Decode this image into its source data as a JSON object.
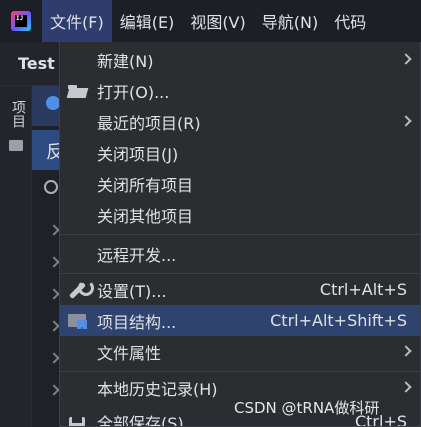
{
  "menubar": {
    "logo_text": "IJ",
    "items": [
      {
        "label": "文件(F)"
      },
      {
        "label": "编辑(E)"
      },
      {
        "label": "视图(V)"
      },
      {
        "label": "导航(N)"
      },
      {
        "label": "代码"
      }
    ]
  },
  "background": {
    "tab_label": "Test",
    "sidebar_label": "项目",
    "panel_row_text": "反"
  },
  "file_menu": {
    "items": [
      {
        "label": "新建(N)",
        "shortcut": "",
        "has_submenu": true,
        "icon": ""
      },
      {
        "label": "打开(O)...",
        "shortcut": "",
        "has_submenu": false,
        "icon": "folder-open-icon"
      },
      {
        "label": "最近的项目(R)",
        "shortcut": "",
        "has_submenu": true,
        "icon": ""
      },
      {
        "label": "关闭项目(J)",
        "shortcut": "",
        "has_submenu": false,
        "icon": ""
      },
      {
        "label": "关闭所有项目",
        "shortcut": "",
        "has_submenu": false,
        "icon": ""
      },
      {
        "label": "关闭其他项目",
        "shortcut": "",
        "has_submenu": false,
        "icon": ""
      },
      {
        "label": "远程开发...",
        "shortcut": "",
        "has_submenu": false,
        "icon": ""
      },
      {
        "label": "设置(T)...",
        "shortcut": "Ctrl+Alt+S",
        "has_submenu": false,
        "icon": "wrench-icon"
      },
      {
        "label": "项目结构...",
        "shortcut": "Ctrl+Alt+Shift+S",
        "has_submenu": false,
        "icon": "project-structure-icon",
        "highlighted": true
      },
      {
        "label": "文件属性",
        "shortcut": "",
        "has_submenu": true,
        "icon": ""
      },
      {
        "label": "本地历史记录(H)",
        "shortcut": "",
        "has_submenu": true,
        "icon": ""
      },
      {
        "label": "全部保存(S)",
        "shortcut": "Ctrl+S",
        "has_submenu": false,
        "icon": "save-icon"
      }
    ]
  },
  "watermark": "CSDN @tRNA做科研",
  "colors": {
    "menubar_bg": "#1c1f26",
    "menu_bg": "#2b2d30",
    "highlight": "#2e436e",
    "active_menu": "#2f3d6e",
    "text": "#dfe1e5"
  }
}
